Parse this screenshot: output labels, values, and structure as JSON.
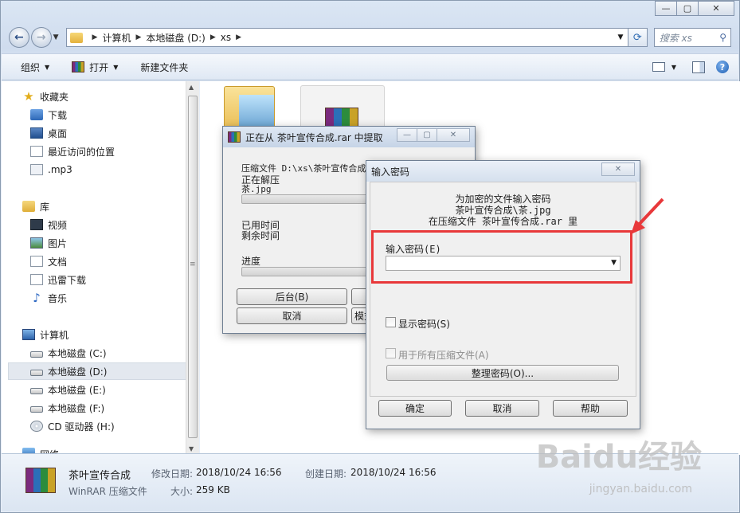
{
  "explorer": {
    "breadcrumbs": [
      "计算机",
      "本地磁盘 (D:)",
      "xs"
    ],
    "search_placeholder": "搜索 xs",
    "toolbar": {
      "organize": "组织",
      "open": "打开",
      "new_folder": "新建文件夹"
    },
    "nav": {
      "favorites": "收藏夹",
      "favorites_items": [
        "下载",
        "桌面",
        "最近访问的位置",
        ".mp3"
      ],
      "libraries": "库",
      "library_items": [
        "视频",
        "图片",
        "文档",
        "迅雷下载",
        "音乐"
      ],
      "computer": "计算机",
      "drives": [
        "本地磁盘 (C:)",
        "本地磁盘 (D:)",
        "本地磁盘 (E:)",
        "本地磁盘 (F:)",
        "CD 驱动器 (H:)"
      ],
      "network": "网络"
    },
    "status": {
      "name": "茶叶宣传合成",
      "type": "WinRAR 压缩文件",
      "modified_label": "修改日期:",
      "modified": "2018/10/24 16:56",
      "created_label": "创建日期:",
      "created": "2018/10/24 16:56",
      "size_label": "大小:",
      "size": "259 KB"
    }
  },
  "extract_dialog": {
    "title": "正在从 茶叶宣传合成.rar 中提取",
    "archive_line": "压缩文件 D:\\xs\\茶叶宣传合成",
    "extracting": "正在解压",
    "file": "茶.jpg",
    "elapsed": "已用时间",
    "remaining": "剩余时间",
    "progress": "进度",
    "background_btn": "后台(B)",
    "cancel_btn": "取消",
    "mode_btn": "模式"
  },
  "password_dialog": {
    "title": "输入密码",
    "info_line1": "为加密的文件输入密码",
    "info_line2": "茶叶宣传合成\\茶.jpg",
    "info_line3": "在压缩文件 茶叶宣传合成.rar 里",
    "input_label": "输入密码(E)",
    "input_value": "",
    "show_password": "显示密码(S)",
    "use_for_all": "用于所有压缩文件(A)",
    "organize_btn": "整理密码(O)...",
    "ok_btn": "确定",
    "cancel_btn": "取消",
    "help_btn": "帮助"
  },
  "watermark": {
    "text": "Baidu经验",
    "url": "jingyan.baidu.com"
  },
  "colors": {
    "callout": "#e8383a",
    "selection": "#e3e8ef"
  }
}
